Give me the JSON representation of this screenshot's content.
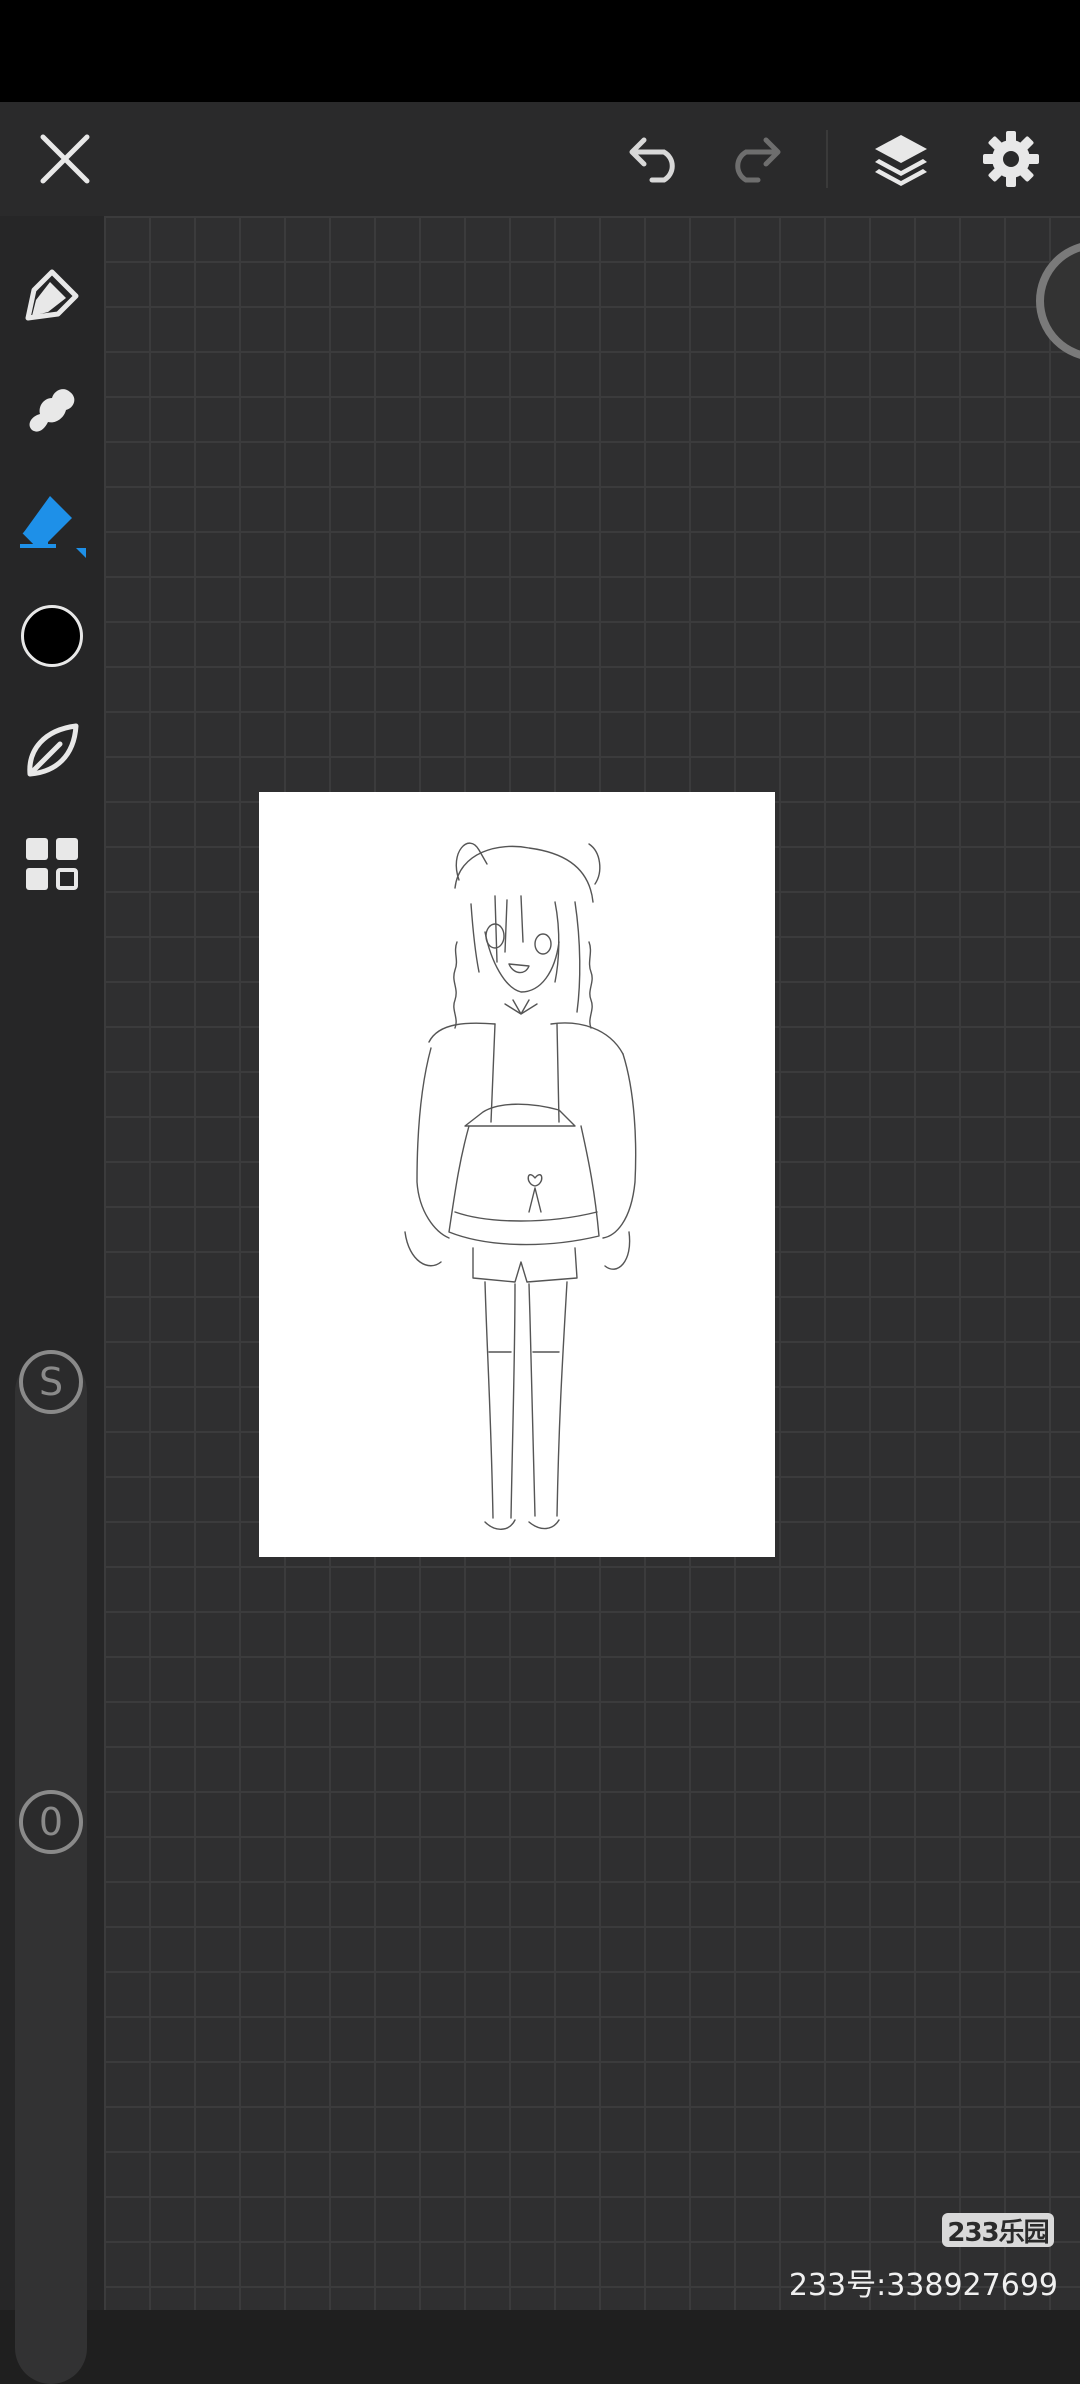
{
  "toolbar": {
    "close_icon": "close-icon",
    "undo_icon": "undo-icon",
    "redo_icon": "redo-icon",
    "layers_icon": "layers-icon",
    "settings_icon": "gear-icon"
  },
  "sidebar": {
    "tools": [
      {
        "name": "pen",
        "icon": "pen-nib-icon",
        "active": false
      },
      {
        "name": "smudge",
        "icon": "smudge-icon",
        "active": false
      },
      {
        "name": "eraser",
        "icon": "eraser-icon",
        "active": true
      },
      {
        "name": "color",
        "icon": "color-swatch-icon",
        "color": "#000000"
      },
      {
        "name": "brush-library",
        "icon": "leaf-icon",
        "active": false
      },
      {
        "name": "gallery",
        "icon": "grid-icon",
        "active": false
      }
    ],
    "size_slider": {
      "label": "S"
    },
    "opacity_slider": {
      "label": "0"
    }
  },
  "colors": {
    "accent": "#1e90e8",
    "icon": "#e8e8e8",
    "icon_dim": "#6e6e6e"
  },
  "watermark": {
    "logo": "233乐园",
    "id_text": "233号:338927699"
  }
}
